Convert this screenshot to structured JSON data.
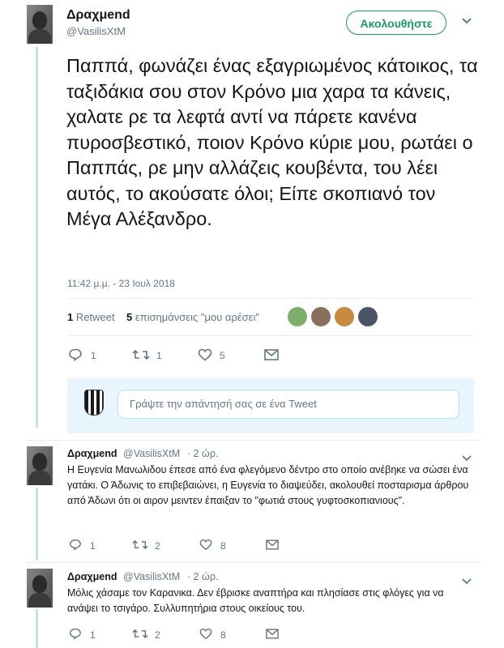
{
  "tweet": {
    "author_name": "Δραχμend",
    "author_handle": "@VasilisXtM",
    "follow_label": "Ακολουθήστε",
    "text": "Παππά, φωνάζει ένας εξαγριωμένος κάτοικος, τα ταξιδάκια σου στον Κρόνο μια χαρα τα κάνεις, χαλατε ρε τα λεφτά αντί να πάρετε κανένα πυροσβεστικό, ποιον Κρόνο κύριε μου, ρωτάει ο Παππάς, ρε μην αλλάζεις κουβέντα, του λέει αυτός, το ακούσατε όλοι; Είπε σκοπιανό τον Μέγα Αλέξανδρο.",
    "timestamp": "11:42 μ.μ. - 23 Ιουλ 2018",
    "retweets_count": "1",
    "retweets_label": "Retweet",
    "likes_count": "5",
    "likes_label": "επισημάνσεις \"μου αρέσει\"",
    "actions": {
      "reply_count": "1",
      "retweet_count": "1",
      "like_count": "5"
    },
    "likers": [
      "#7fae6a",
      "#8a6f5c",
      "#c98a3f",
      "#4a5566"
    ]
  },
  "reply_box": {
    "placeholder": "Γράψτε την απάντησή σας σε ένα Tweet"
  },
  "replies": [
    {
      "author_name": "Δραχμend",
      "author_handle": "@VasilisXtM",
      "time": "· 2 ώρ.",
      "text": "Η Ευγενία Μανωλιδου έπεσε από ένα φλεγόμενο δέντρο στο οποίο ανέβηκε να σώσει ένα γατάκι. Ο Άδωνις το επιβεβαιώνει, η Ευγενία το διαψεύδει, ακολουθεί ποσταρισμα άρθρου από Άδωνι ότι οι αιρον μειντεν έπαιξαν το \"φωτιά στους γυφτοσκοπιανιους\".",
      "reply_count": "1",
      "retweet_count": "2",
      "like_count": "8"
    },
    {
      "author_name": "Δραχμend",
      "author_handle": "@VasilisXtM",
      "time": "· 2 ώρ.",
      "text": "Μόλις χάσαμε τον Καρανικα. Δεν έβρισκε αναπτήρα και πλησίασε στις φλόγες για να ανάψει το τσιγάρο. Συλλυπητήρια στους οικείους του.",
      "reply_count": "1",
      "retweet_count": "2",
      "like_count": "8"
    }
  ],
  "colors": {
    "accent": "#1da1f2",
    "follow_green": "#1b9a64",
    "thread_line": "#c5e1ee"
  }
}
